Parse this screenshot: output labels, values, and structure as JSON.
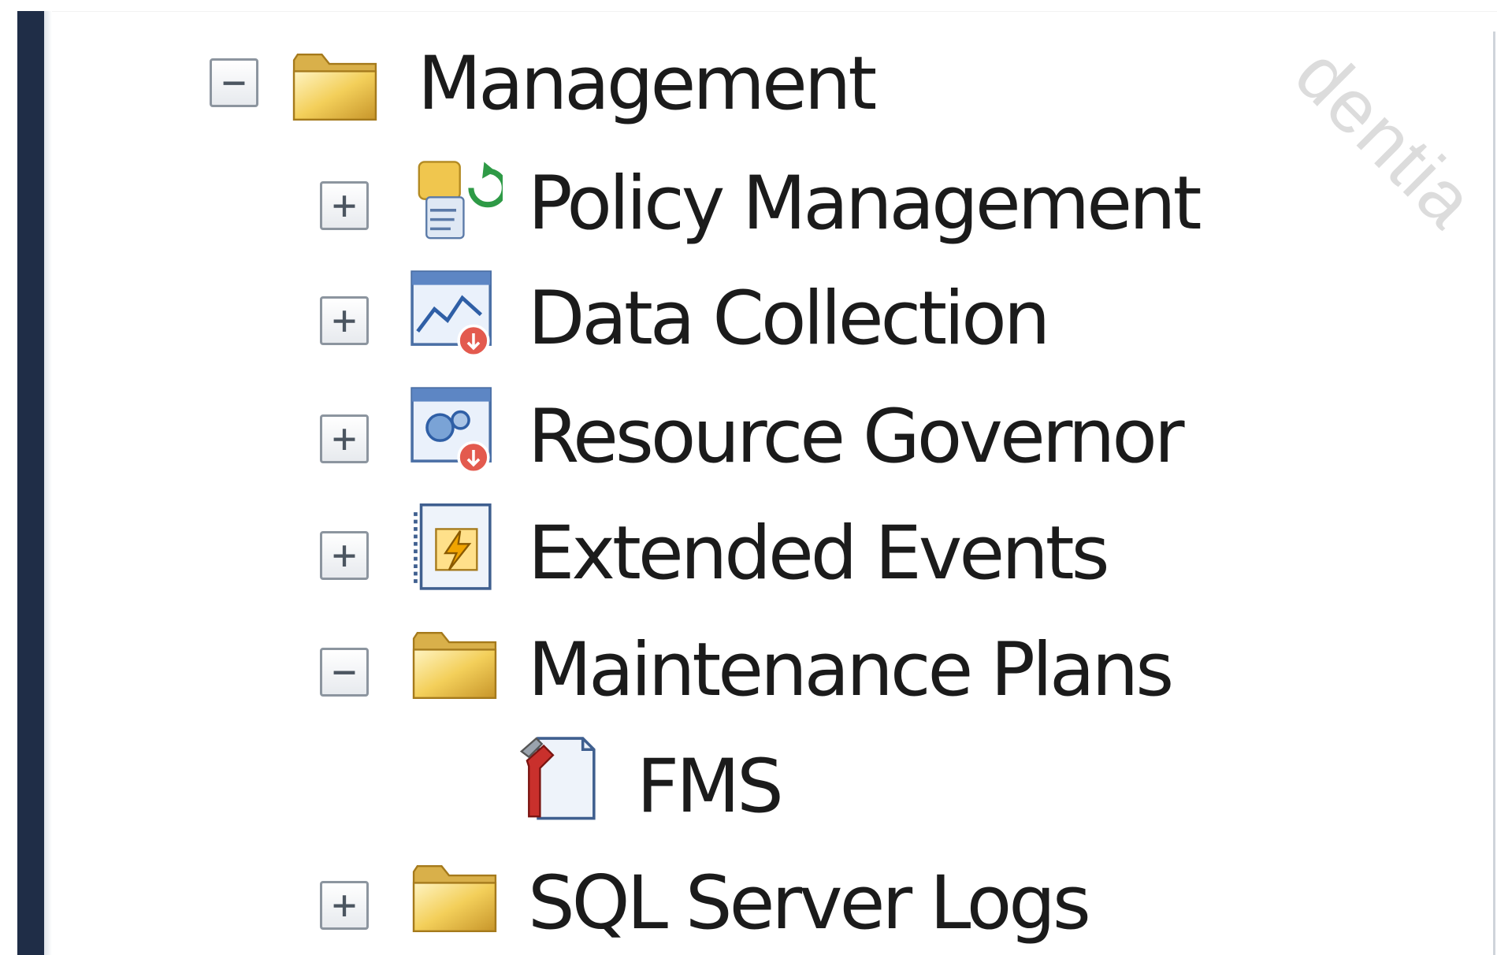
{
  "tree": {
    "management": {
      "label": "Management",
      "toggle": "−",
      "icon": "folder-icon"
    },
    "children": [
      {
        "label": "Policy Management",
        "toggle": "+",
        "icon": "policy-management-icon"
      },
      {
        "label": "Data Collection",
        "toggle": "+",
        "icon": "data-collection-icon"
      },
      {
        "label": "Resource Governor",
        "toggle": "+",
        "icon": "resource-governor-icon"
      },
      {
        "label": "Extended Events",
        "toggle": "+",
        "icon": "extended-events-icon"
      },
      {
        "label": "Maintenance Plans",
        "toggle": "−",
        "icon": "folder-icon"
      },
      {
        "label": "FMS",
        "toggle": "",
        "icon": "maintenance-plan-icon"
      },
      {
        "label": "SQL Server Logs",
        "toggle": "+",
        "icon": "folder-icon"
      }
    ]
  },
  "watermark": {
    "text": "dentia"
  },
  "colors": {
    "sidebar": "#1f2d47",
    "folder_yellow": "#f2c94c",
    "text": "#1b1b1b"
  }
}
